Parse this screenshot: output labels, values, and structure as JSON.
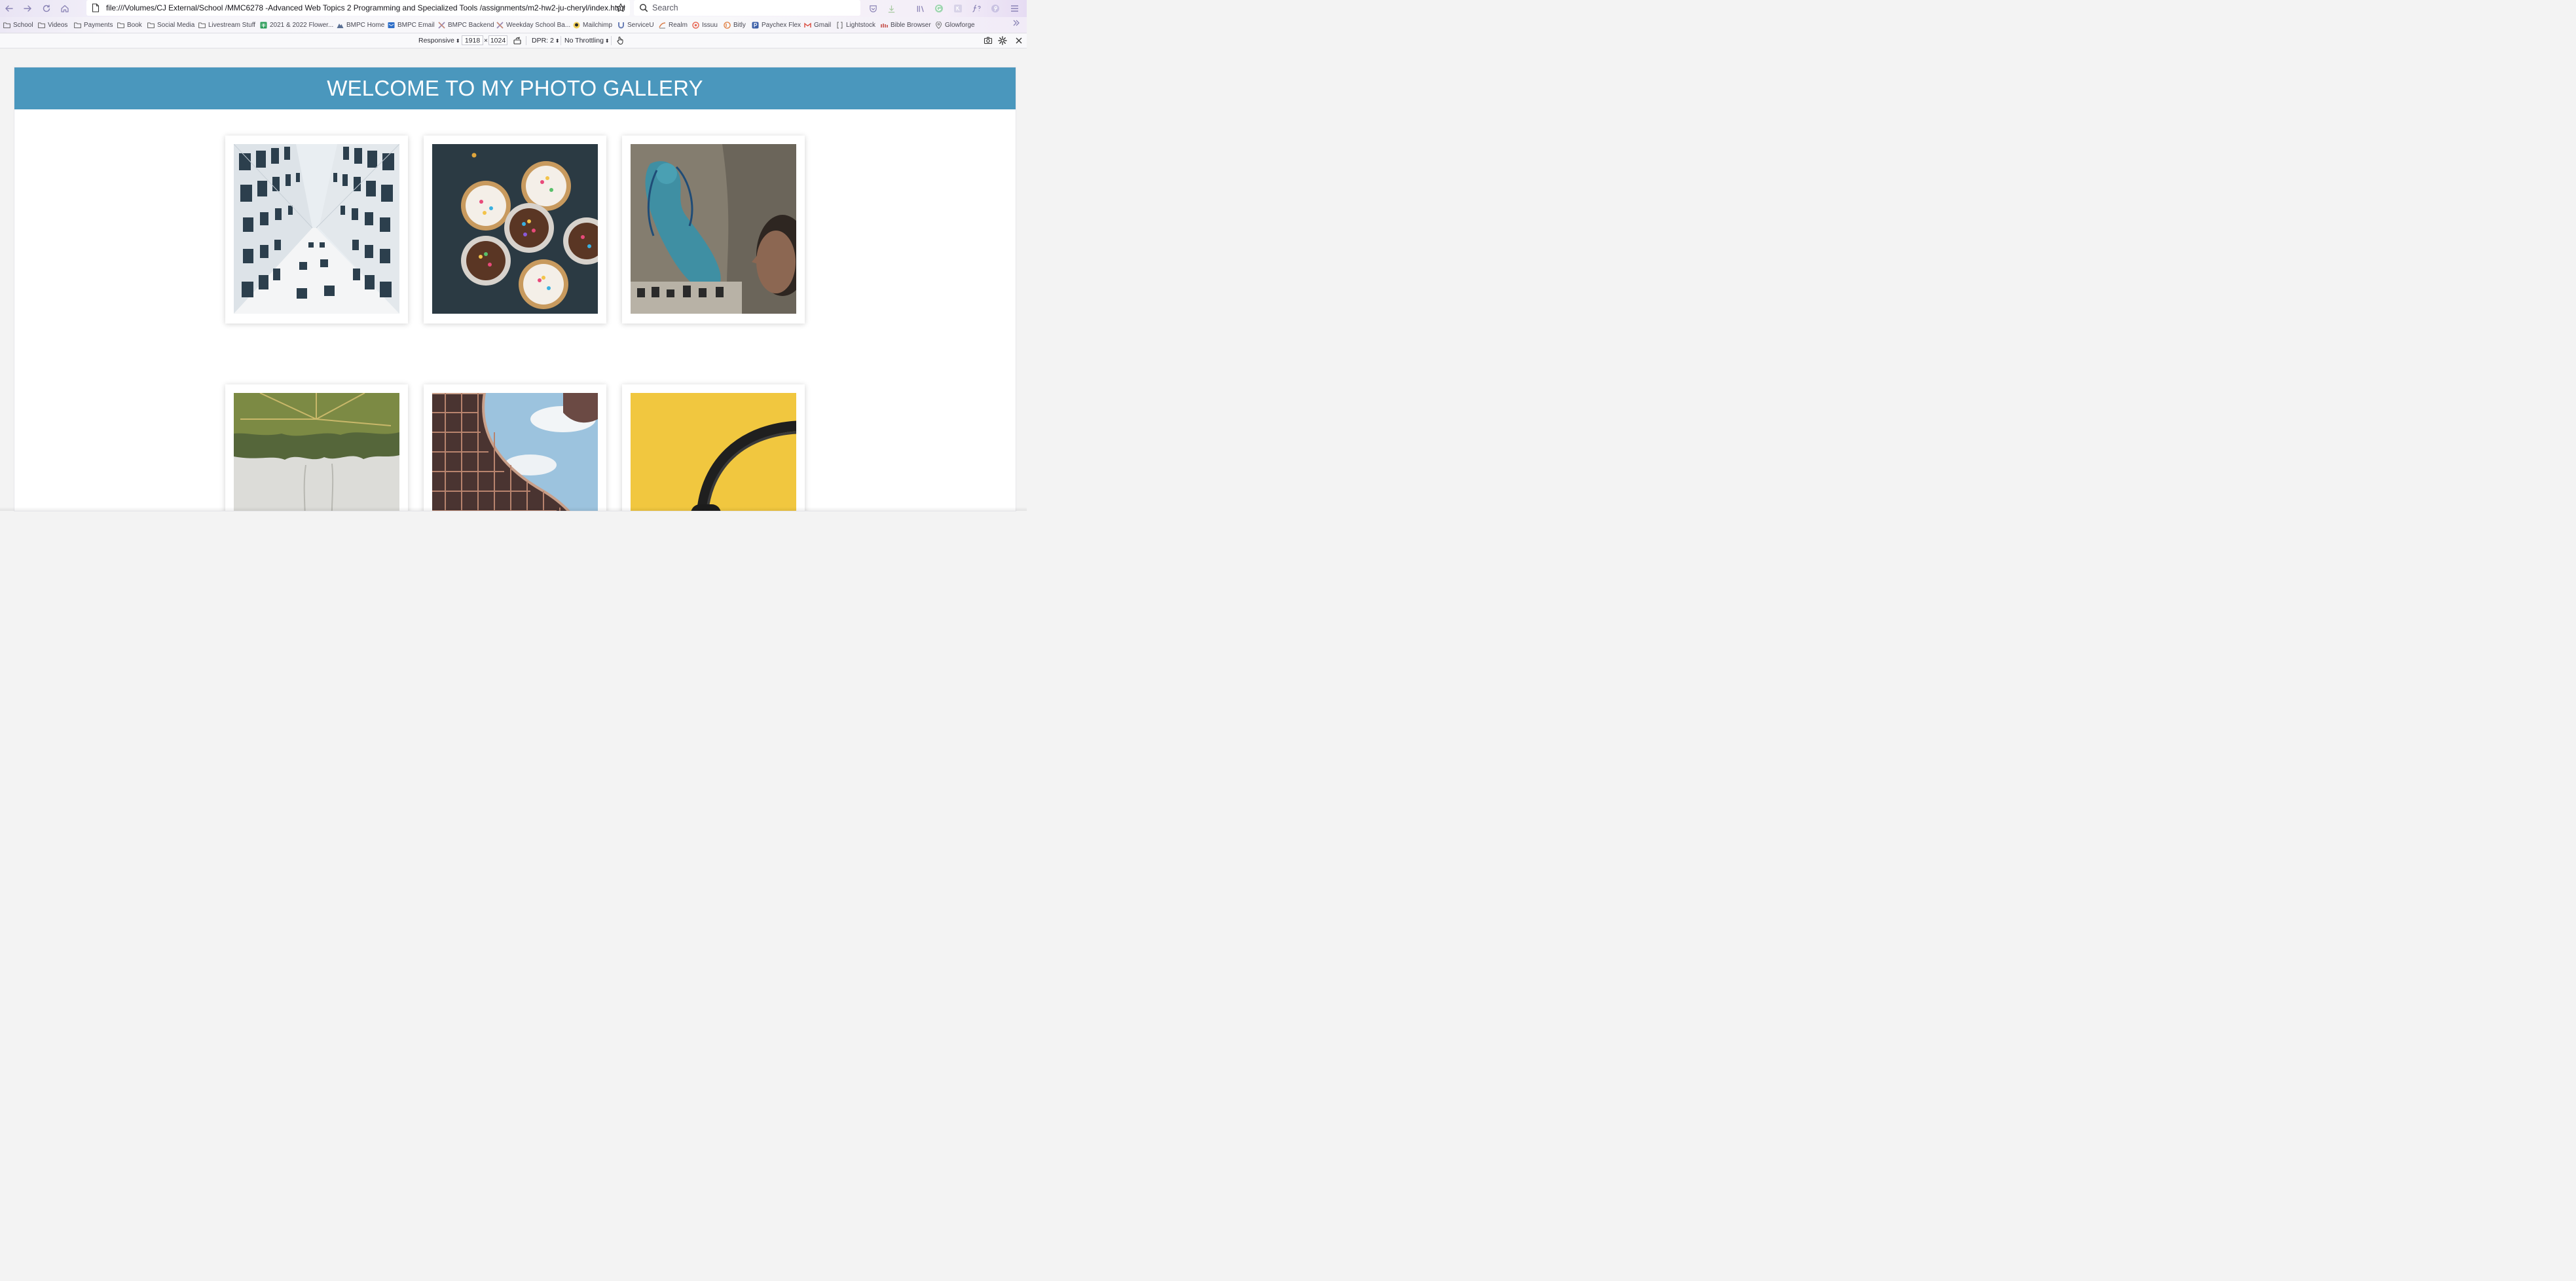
{
  "browser": {
    "url": "file:///Volumes/CJ External/School /MMC6278 -Advanced Web Topics 2 Programming and Specialized Tools /assignments/m2-hw2-ju-cheryl/index.html",
    "search_placeholder": "Search",
    "accent_color": "#8a83b5"
  },
  "bookmarks": [
    {
      "label": "School",
      "icon": "folder-icon"
    },
    {
      "label": "Videos",
      "icon": "folder-icon"
    },
    {
      "label": "Payments",
      "icon": "folder-icon"
    },
    {
      "label": "Book",
      "icon": "folder-icon"
    },
    {
      "label": "Social Media",
      "icon": "folder-icon"
    },
    {
      "label": "Livestream Stuff",
      "icon": "folder-icon"
    },
    {
      "label": "2021 & 2022 Flower...",
      "icon": "sheet-icon"
    },
    {
      "label": "BMPC Home",
      "icon": "mountain-icon"
    },
    {
      "label": "BMPC Email",
      "icon": "mail-icon"
    },
    {
      "label": "BMPC Backend",
      "icon": "x-icon"
    },
    {
      "label": "Weekday School Ba...",
      "icon": "x-icon"
    },
    {
      "label": "Mailchimp",
      "icon": "mailchimp-icon"
    },
    {
      "label": "ServiceU",
      "icon": "u-icon"
    },
    {
      "label": "Realm",
      "icon": "realm-icon"
    },
    {
      "label": "Issuu",
      "icon": "issuu-icon"
    },
    {
      "label": "Bitly",
      "icon": "bitly-icon"
    },
    {
      "label": "Paychex Flex",
      "icon": "p-icon"
    },
    {
      "label": "Gmail",
      "icon": "gmail-icon"
    },
    {
      "label": "Lightstock",
      "icon": "bracket-icon"
    },
    {
      "label": "Bible Browser",
      "icon": "bible-icon"
    },
    {
      "label": "Glowforge",
      "icon": "pin-icon"
    }
  ],
  "responsive": {
    "mode": "Responsive",
    "width": "1918",
    "times": "×",
    "height": "1024",
    "dpr": "DPR: 2",
    "throttling": "No Throttling"
  },
  "page": {
    "heading": "WELCOME TO MY PHOTO GALLERY",
    "banner_color": "#4a97bd",
    "photos": [
      {
        "subject": "building-windows-looking-up"
      },
      {
        "subject": "cupcakes-with-sprinkles"
      },
      {
        "subject": "blue-mural-street-art-with-person"
      },
      {
        "subject": "palm-trees-looking-up"
      },
      {
        "subject": "curved-modern-building-with-sky"
      },
      {
        "subject": "headphones-on-yellow"
      }
    ]
  }
}
